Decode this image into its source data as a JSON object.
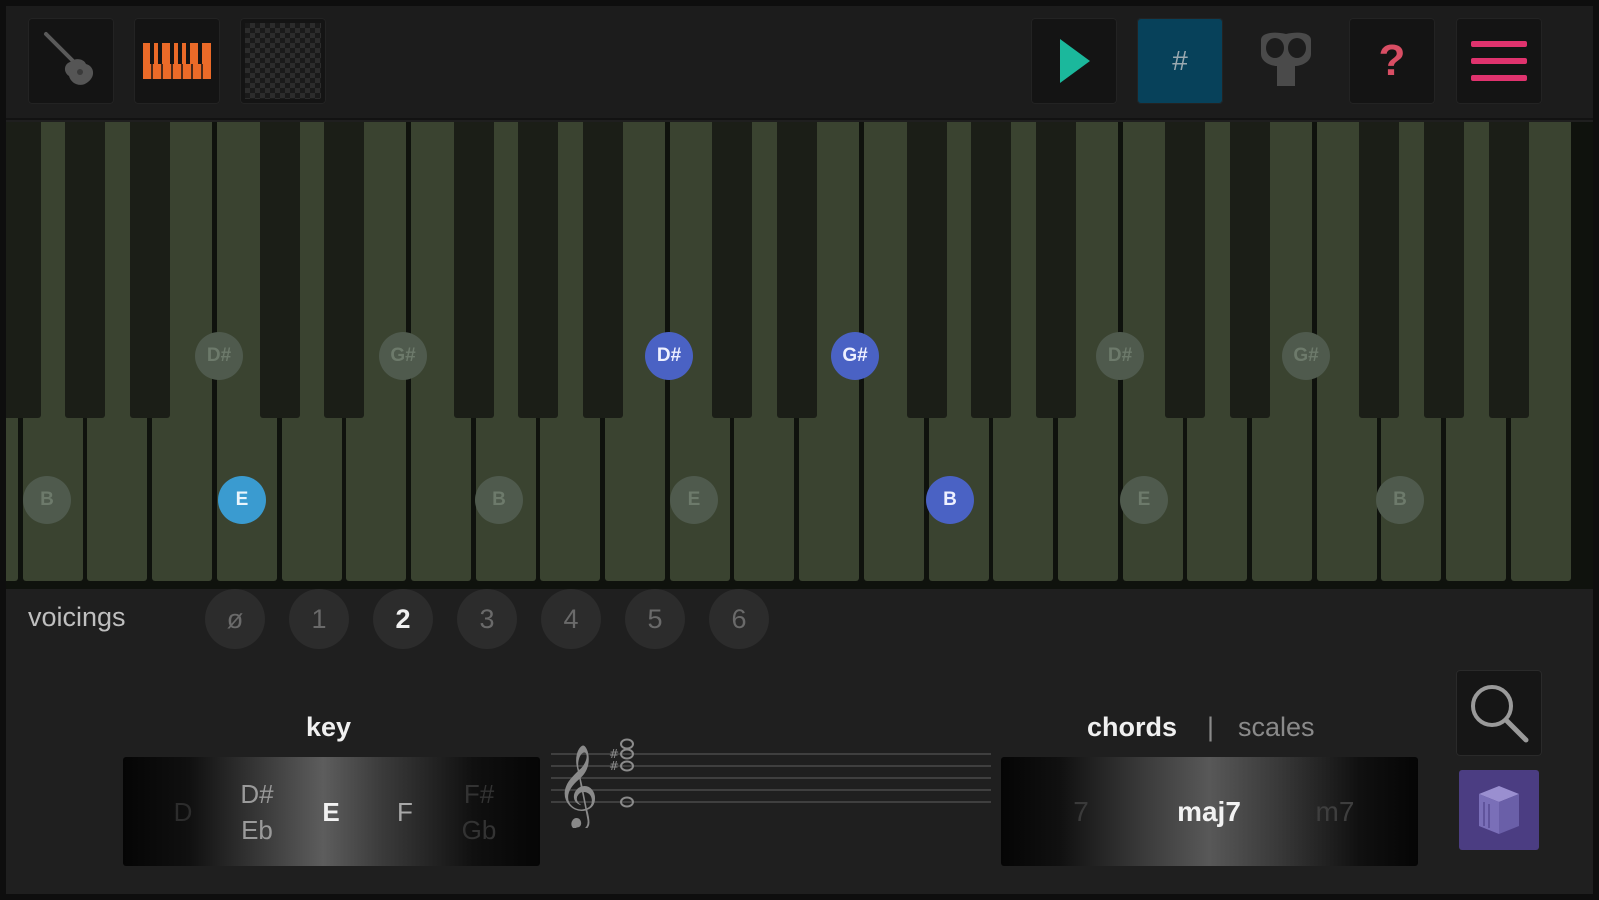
{
  "toolbar": {
    "guitar_icon": "guitar-icon",
    "piano_icon": "piano-keyboard-icon",
    "pattern_icon": "checker-pattern-icon",
    "play_icon": "play-icon",
    "sharp_label": "#",
    "mask_icon": "mask-icon",
    "help_label": "?",
    "menu_icon": "hamburger-menu-icon",
    "accent_orange": "#ea6a28",
    "accent_teal": "#1bb89c",
    "accent_pink": "#e0336e"
  },
  "keyboard": {
    "notes": [
      {
        "label": "D#",
        "state": "dim"
      },
      {
        "label": "G#",
        "state": "dim"
      },
      {
        "label": "D#",
        "state": "active"
      },
      {
        "label": "G#",
        "state": "active"
      },
      {
        "label": "D#",
        "state": "dim"
      },
      {
        "label": "G#",
        "state": "dim"
      },
      {
        "label": "B",
        "state": "dim"
      },
      {
        "label": "E",
        "state": "root"
      },
      {
        "label": "B",
        "state": "dim"
      },
      {
        "label": "E",
        "state": "dim"
      },
      {
        "label": "B",
        "state": "active"
      },
      {
        "label": "E",
        "state": "dim"
      },
      {
        "label": "B",
        "state": "dim"
      }
    ]
  },
  "voicings": {
    "label": "voicings",
    "options": [
      "ø",
      "1",
      "2",
      "3",
      "4",
      "5",
      "6"
    ],
    "selected": "2"
  },
  "key_picker": {
    "title": "key",
    "items": [
      {
        "top": "D",
        "bottom": ""
      },
      {
        "top": "D#",
        "bottom": "Eb"
      },
      {
        "top": "E",
        "bottom": ""
      },
      {
        "top": "F",
        "bottom": ""
      },
      {
        "top": "F#",
        "bottom": "Gb"
      }
    ],
    "selected": "E"
  },
  "chord_picker": {
    "tab_chords": "chords",
    "separator": "|",
    "tab_scales": "scales",
    "items": [
      "7",
      "maj7",
      "m7"
    ],
    "selected": "maj7"
  },
  "side": {
    "search_icon": "search-icon",
    "book_icon": "book-icon",
    "book_color": "#4b3d82"
  }
}
